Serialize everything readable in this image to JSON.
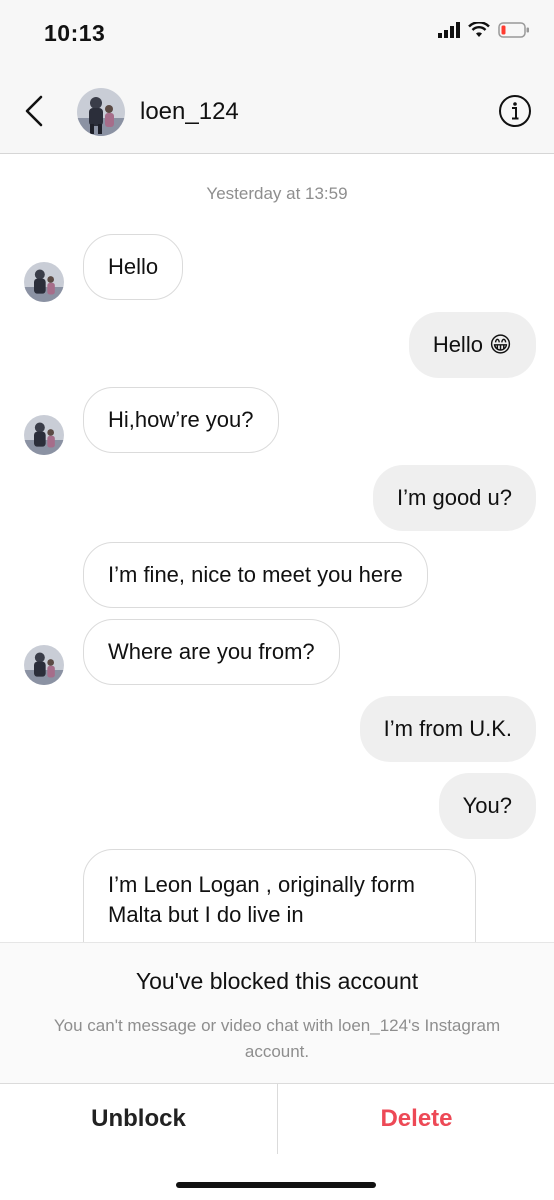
{
  "status": {
    "time": "10:13"
  },
  "header": {
    "username": "loen_124"
  },
  "chat": {
    "timestamp": "Yesterday at 13:59",
    "messages": [
      {
        "from": "them",
        "text": "Hello"
      },
      {
        "from": "me",
        "text": "Hello 😁"
      },
      {
        "from": "them",
        "text": "Hi,how’re you?"
      },
      {
        "from": "me",
        "text": "I’m good u?"
      },
      {
        "from": "them",
        "text": "I’m fine, nice to meet you here"
      },
      {
        "from": "them",
        "text": "Where are you from?"
      },
      {
        "from": "me",
        "text": "I’m from U.K."
      },
      {
        "from": "me",
        "text": "You?"
      },
      {
        "from": "them",
        "text": "I’m Leon Logan , originally form Malta but I do live in"
      }
    ]
  },
  "blocked": {
    "title": "You've blocked this account",
    "subtitle": "You can't message or video chat with loen_124's Instagram account."
  },
  "actions": {
    "unblock": "Unblock",
    "delete": "Delete"
  },
  "colors": {
    "delete": "#ed4956",
    "battery_low": "#ff3b30"
  }
}
